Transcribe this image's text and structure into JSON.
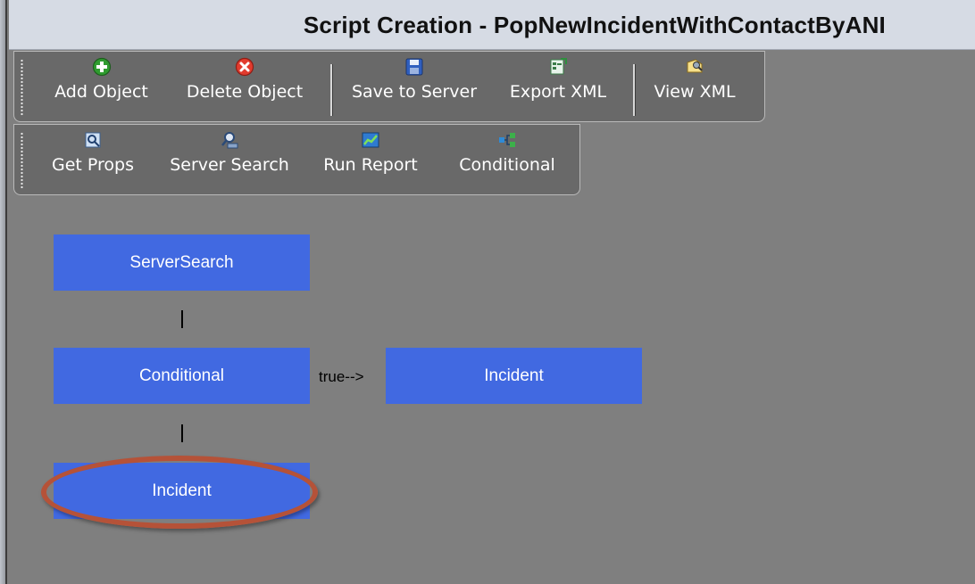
{
  "window": {
    "title": "Script Creation - PopNewIncidentWithContactByANI"
  },
  "toolbar1": {
    "add_object": "Add Object",
    "delete_object": "Delete Object",
    "save_to_server": "Save to Server",
    "export_xml": "Export XML",
    "view_xml": "View XML"
  },
  "toolbar2": {
    "get_props": "Get Props",
    "server_search": "Server Search",
    "run_report": "Run Report",
    "conditional": "Conditional"
  },
  "diagram": {
    "nodes": [
      {
        "label": "ServerSearch"
      },
      {
        "label": "Conditional"
      },
      {
        "label": "Incident"
      },
      {
        "label": "Incident"
      }
    ],
    "connectors": [
      "|",
      "|"
    ],
    "edge_label": "true-->",
    "node_color": "#4169e1",
    "highlight_color": "#b55238"
  }
}
